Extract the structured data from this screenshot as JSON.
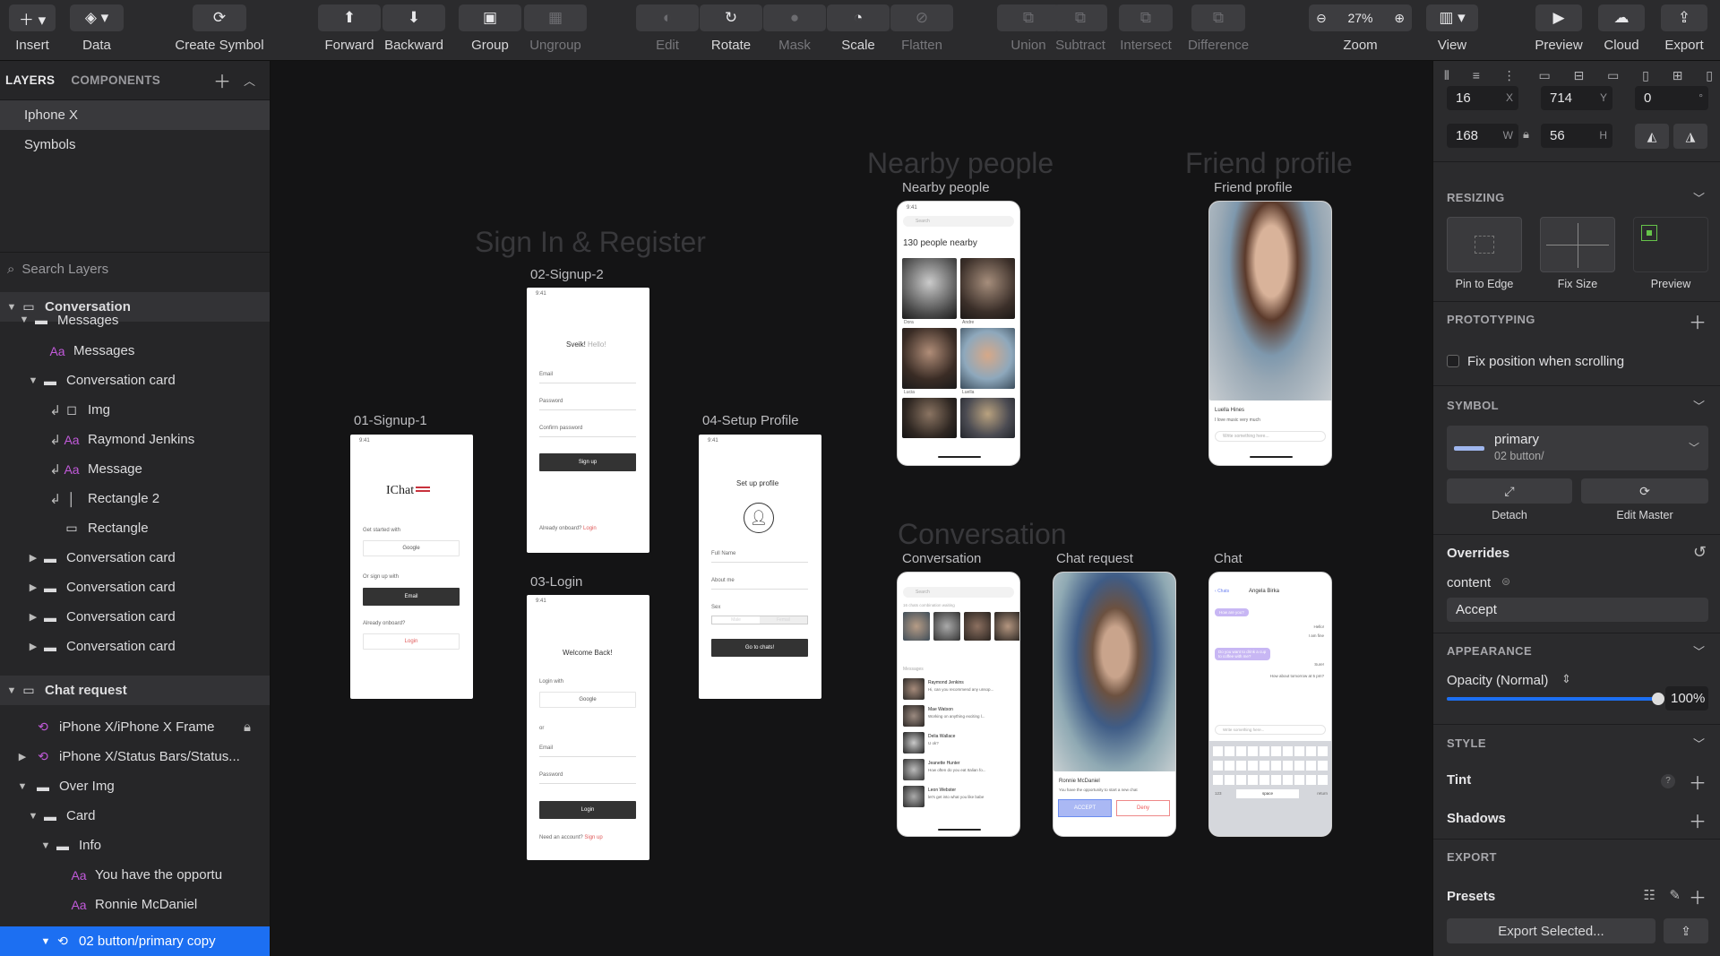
{
  "toolbar": [
    {
      "label": "Insert",
      "icon": "plus-icon"
    },
    {
      "label": "Data",
      "icon": "layers-icon"
    },
    {
      "label": "Create Symbol",
      "icon": "sync-icon"
    },
    {
      "label": "Forward",
      "icon": "forward-icon"
    },
    {
      "label": "Backward",
      "icon": "backward-icon"
    },
    {
      "label": "Group",
      "icon": "group-icon"
    },
    {
      "label": "Ungroup",
      "icon": "ungroup-icon"
    },
    {
      "label": "Edit",
      "icon": "edit-icon"
    },
    {
      "label": "Rotate",
      "icon": "rotate-icon"
    },
    {
      "label": "Mask",
      "icon": "mask-icon"
    },
    {
      "label": "Scale",
      "icon": "scale-icon"
    },
    {
      "label": "Flatten",
      "icon": "flatten-icon"
    },
    {
      "label": "Union",
      "icon": "union-icon"
    },
    {
      "label": "Subtract",
      "icon": "subtract-icon"
    },
    {
      "label": "Intersect",
      "icon": "intersect-icon"
    },
    {
      "label": "Difference",
      "icon": "difference-icon"
    },
    {
      "label": "Zoom",
      "icon": "zoom-icon",
      "value": "27%"
    },
    {
      "label": "View",
      "icon": "view-icon"
    },
    {
      "label": "Preview",
      "icon": "play-icon"
    },
    {
      "label": "Cloud",
      "icon": "cloud-icon"
    },
    {
      "label": "Export",
      "icon": "export-icon"
    }
  ],
  "left": {
    "tabs": [
      "LAYERS",
      "COMPONENTS"
    ],
    "pages": [
      "Iphone X",
      "Symbols"
    ],
    "search_placeholder": "Search Layers",
    "layers": [
      {
        "label": "Conversation"
      },
      {
        "label": "Messages"
      },
      {
        "label": "Messages"
      },
      {
        "label": "Conversation card"
      },
      {
        "label": "Img"
      },
      {
        "label": "Raymond Jenkins"
      },
      {
        "label": "Message"
      },
      {
        "label": "Rectangle 2"
      },
      {
        "label": "Rectangle"
      },
      {
        "label": "Conversation card"
      },
      {
        "label": "Conversation card"
      },
      {
        "label": "Conversation card"
      },
      {
        "label": "Conversation card"
      },
      {
        "label": "Chat request"
      },
      {
        "label": "iPhone X/iPhone X Frame"
      },
      {
        "label": "iPhone X/Status Bars/Status..."
      },
      {
        "label": "Over Img"
      },
      {
        "label": "Card"
      },
      {
        "label": "Info"
      },
      {
        "label": "You have the opportu"
      },
      {
        "label": "Ronnie McDaniel"
      },
      {
        "label": "02 button/primary copy"
      }
    ]
  },
  "canvas": {
    "sections": [
      "Sign In & Register",
      "Nearby people",
      "Friend profile",
      "Conversation"
    ],
    "artboards": [
      "01-Signup-1",
      "02-Signup-2",
      "03-Login",
      "04-Setup Profile",
      "Nearby people",
      "Friend profile",
      "Conversation",
      "Chat request",
      "Chat"
    ],
    "screens": {
      "time": "9:41",
      "logo": "IChat",
      "get_started": "Get started with",
      "google": "Google",
      "or_sign_up": "Or sign up with",
      "email_btn": "Email",
      "already": "Already onboard?",
      "login": "Login",
      "hello_a": "Sveik!",
      "hello_b": "Hello!",
      "email": "Email",
      "password": "Password",
      "confirm": "Confirm password",
      "sign_up": "Sign up",
      "welcome": "Welcome Back!",
      "login_with": "Login with",
      "or": "or",
      "need_account": "Need an account?",
      "setup": "Set up profile",
      "full_name": "Full Name",
      "about": "About me",
      "sex": "Sex",
      "male": "Male",
      "female": "Femail",
      "go": "Go to chats!",
      "search": "Search",
      "nearby_count": "130 people nearby",
      "nearby_names": [
        "Dora",
        "Andre",
        "Lucia",
        "Luella"
      ],
      "friend_name": "Luella Hines",
      "friend_bio": "I love music very much",
      "write": "Write something here...",
      "requests": "16 chats combination waiting",
      "messages_h": "Messages",
      "conv": [
        {
          "name": "Raymond Jenkins",
          "msg": "Hi, can you recommend any unsop..."
        },
        {
          "name": "Mae Watson",
          "msg": "Working on anything exciting l..."
        },
        {
          "name": "Delia Wallace",
          "msg": "U ok?"
        },
        {
          "name": "Jeanette Hunter",
          "msg": "How often do you eat Italian fo..."
        },
        {
          "name": "Leon Webster",
          "msg": "let's get into what you like babe"
        }
      ],
      "req_name": "Ronnie McDaniel",
      "req_text": "You have the opportunity to start a new chat",
      "accept": "ACCEPT",
      "deny": "Deny",
      "chat_back": "Chats",
      "chat_name": "Angela Birka",
      "bubbles": [
        "How are you?",
        "Hello!",
        "I am fine",
        "Do you want to drink a cup to coffee with me?",
        "Sure!",
        "How about tomorrow at 5 pm?"
      ],
      "kb_space": "space",
      "kb_return": "return",
      "kb_123": "123"
    }
  },
  "right": {
    "x": "16",
    "y": "714",
    "rot": "0",
    "w": "168",
    "h": "56",
    "units": {
      "x": "X",
      "y": "Y",
      "w": "W",
      "h": "H",
      "deg": "°"
    },
    "resizing": "RESIZING",
    "resize_opts": [
      "Pin to Edge",
      "Fix Size",
      "Preview"
    ],
    "prototyping": "PROTOTYPING",
    "fix_position": "Fix position when scrolling",
    "symbol": "SYMBOL",
    "symbol_name": "primary",
    "symbol_path": "02 button/",
    "detach": "Detach",
    "edit_master": "Edit Master",
    "overrides": "Overrides",
    "content_label": "content",
    "content_value": "Accept",
    "appearance": "APPEARANCE",
    "opacity_label": "Opacity (Normal)",
    "opacity": "100%",
    "opacity_level": 1.0,
    "style": "STYLE",
    "tint": "Tint",
    "shadows": "Shadows",
    "export": "EXPORT",
    "presets": "Presets",
    "export_btn": "Export Selected...",
    "accent": "#1c6ff2"
  }
}
